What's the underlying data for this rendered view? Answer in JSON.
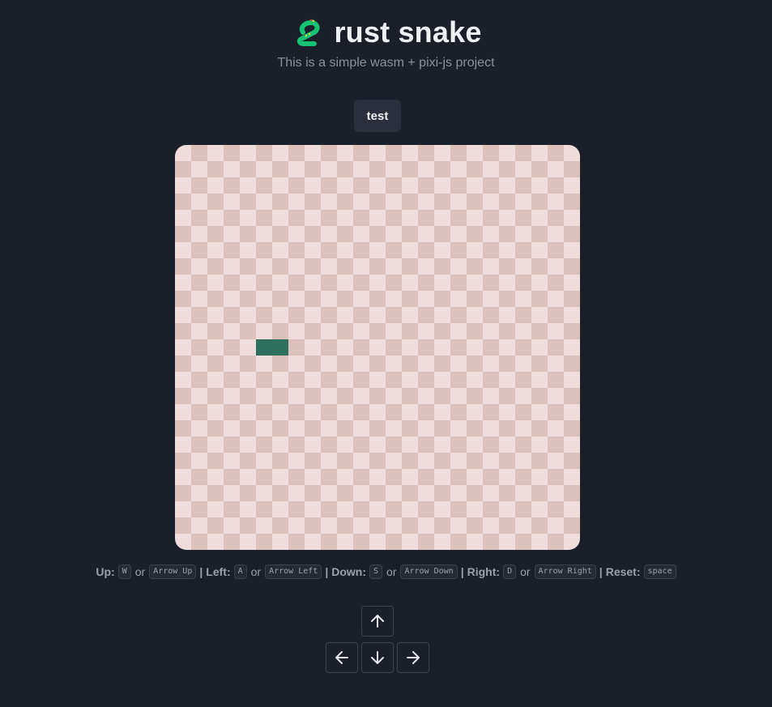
{
  "header": {
    "title": "rust snake",
    "subtitle": "This is a simple wasm + pixi-js project",
    "logo_icon": "snake-icon"
  },
  "test_button": {
    "label": "test"
  },
  "game": {
    "grid": {
      "columns": 25,
      "rows": 25
    },
    "colors": {
      "light_cell": "#f0dcdb",
      "dark_cell": "#dcc1ba",
      "snake": "#2f6f5e"
    },
    "snake": [
      {
        "col": 5,
        "row": 12
      },
      {
        "col": 6,
        "row": 12
      }
    ]
  },
  "controls": {
    "up_label": "Up:",
    "up_key": "W",
    "up_alt": "Arrow Up",
    "left_label": "Left:",
    "left_key": "A",
    "left_alt": "Arrow Left",
    "down_label": "Down:",
    "down_key": "S",
    "down_alt": "Arrow Down",
    "right_label": "Right:",
    "right_key": "D",
    "right_alt": "Arrow Right",
    "reset_label": "Reset:",
    "reset_key": "space",
    "or_word": "or",
    "separator": "|"
  },
  "arrow_pad": {
    "up_icon": "arrow-up-icon",
    "left_icon": "arrow-left-icon",
    "down_icon": "arrow-down-icon",
    "right_icon": "arrow-right-icon"
  }
}
